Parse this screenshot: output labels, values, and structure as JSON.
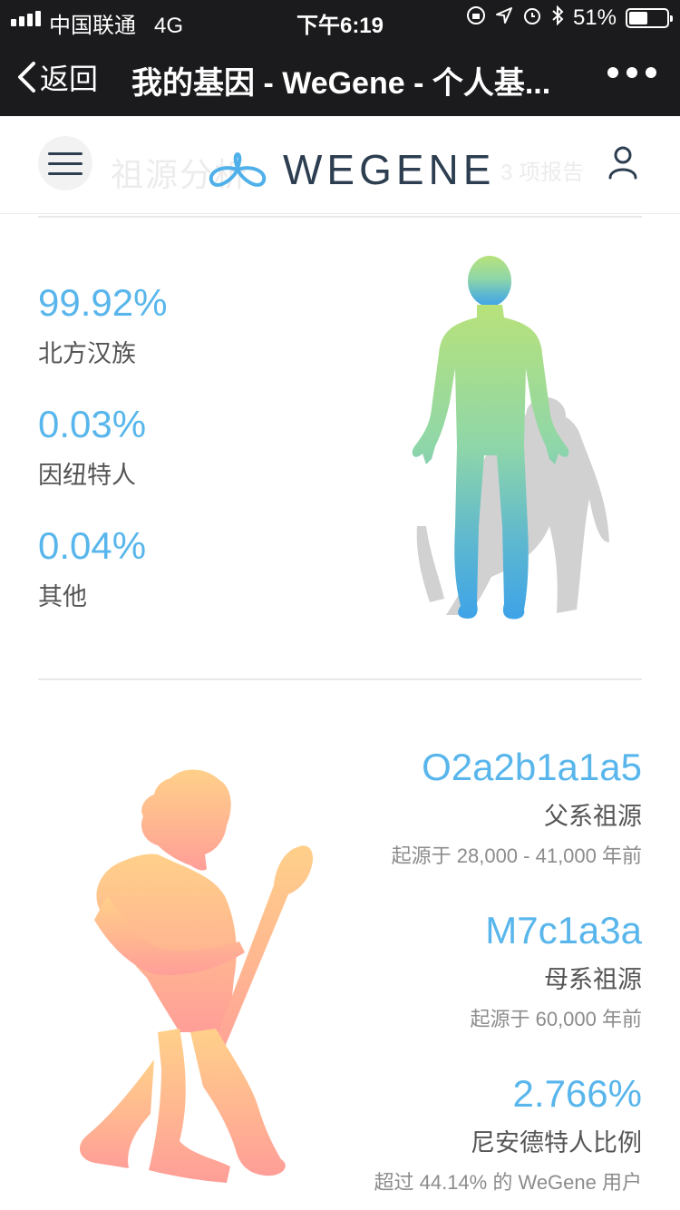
{
  "status_bar": {
    "carrier": "中国联通",
    "network": "4G",
    "time": "下午6:19",
    "battery": "51%",
    "battery_level": 0.51
  },
  "nav": {
    "back_label": "返回",
    "title": "我的基因 - WeGene - 个人基..."
  },
  "header": {
    "faded_section": "祖源分析",
    "faded_count": "3 项报告",
    "logo_text": "WEGENE"
  },
  "ancestry": {
    "items": [
      {
        "value": "99.92%",
        "label": "北方汉族"
      },
      {
        "value": "0.03%",
        "label": "因纽特人"
      },
      {
        "value": "0.04%",
        "label": "其他"
      }
    ]
  },
  "haplogroups": {
    "paternal": {
      "value": "O2a2b1a1a5",
      "label": "父系祖源",
      "sub": "起源于 28,000 - 41,000 年前"
    },
    "maternal": {
      "value": "M7c1a3a",
      "label": "母系祖源",
      "sub": "起源于 60,000 年前"
    },
    "neanderthal": {
      "value": "2.766%",
      "label": "尼安德特人比例",
      "sub": "超过 44.14% 的 WeGene 用户"
    }
  },
  "colors": {
    "accent": "#58b6ec",
    "dark_bar": "#1b1b1d",
    "logo": "#2c3e50"
  }
}
